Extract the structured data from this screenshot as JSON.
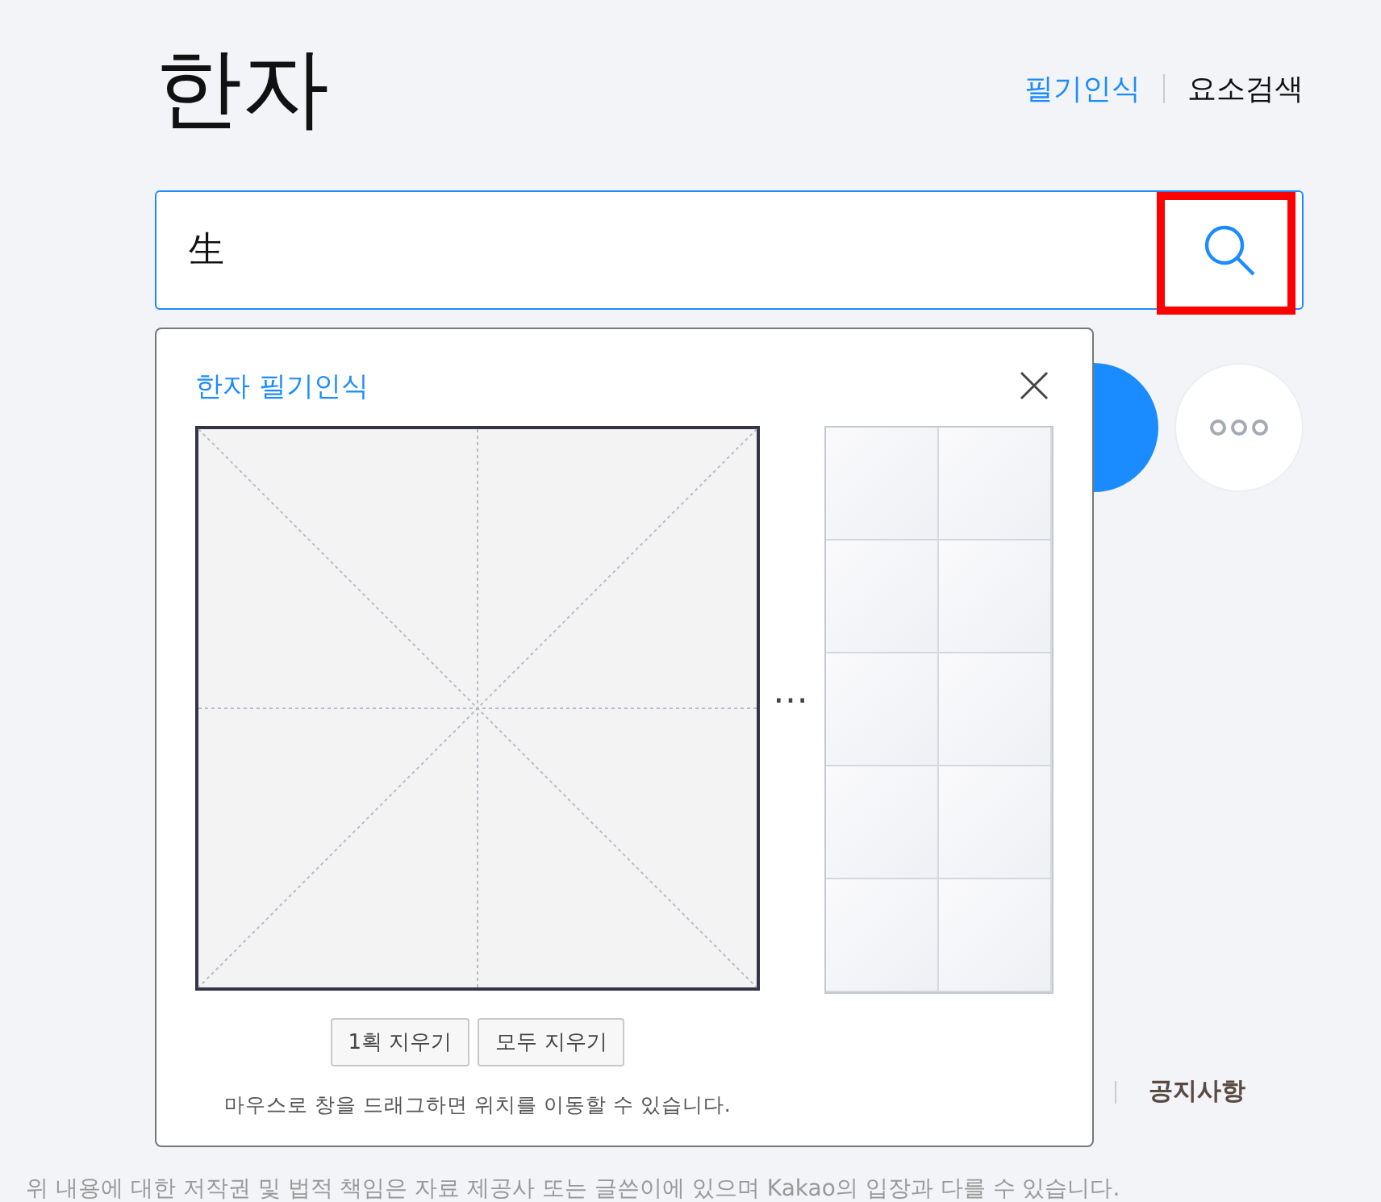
{
  "header": {
    "title": "한자",
    "links": [
      {
        "label": "필기인식",
        "selected": true
      },
      {
        "label": "요소검색",
        "selected": false
      }
    ]
  },
  "search": {
    "value": "生"
  },
  "footer": {
    "link": "공지사항",
    "disclaimer": "위 내용에 대한 저작권 및 법적 책임은 자료 제공사 또는 글쓴이에 있으며 Kakao의 입장과 다를 수 있습니다."
  },
  "handwriting_popup": {
    "title": "한자 필기인식",
    "more": "⋯",
    "buttons": [
      "1획 지우기",
      "모두 지우기"
    ],
    "hint": "마우스로 창을 드래그하면 위치를 이동할 수 있습니다."
  }
}
